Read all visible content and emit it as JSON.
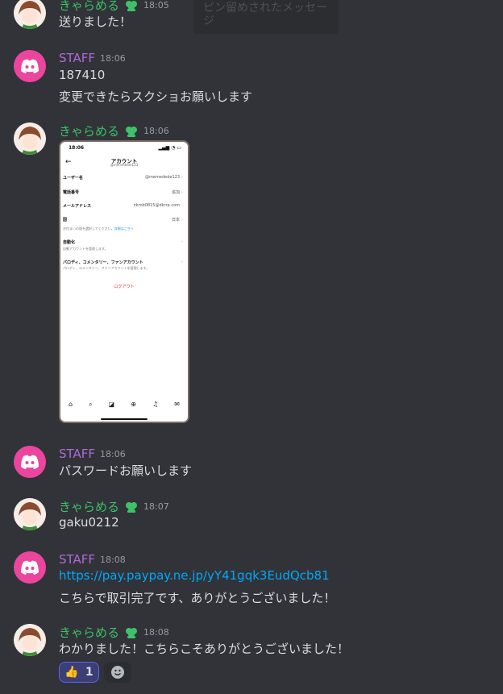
{
  "users": {
    "chara": "きゃらめる",
    "staff": "STAFF"
  },
  "tooltip": "ピン留めされたメッセージ",
  "messages": [
    {
      "time": "18:05",
      "text": "送りました！"
    },
    {
      "time": "18:06",
      "text1": "187410",
      "text2": "変更できたらスクショお願いします"
    },
    {
      "time": "18:06"
    },
    {
      "time": "18:06",
      "text": "パスワードお願いします"
    },
    {
      "time": "18:07",
      "text": "gaku0212"
    },
    {
      "time": "18:08",
      "link": "https://pay.paypay.ne.jp/yY41gqk3EudQcb81",
      "text": "こちらで取引完了です、ありがとうございました！"
    },
    {
      "time": "18:08",
      "text": "わかりました！こちらこそありがとうございました！"
    }
  ],
  "screenshot": {
    "status_time": "18:06",
    "title": "アカウント",
    "handle": "@memedede123",
    "rows": [
      {
        "key": "ユーザー名",
        "value": "@memedede123"
      },
      {
        "key": "電話番号",
        "value": "追加"
      },
      {
        "key": "メールアドレス",
        "value": "nkmb0815@dkrrp.com"
      },
      {
        "key": "国",
        "value": "日本"
      }
    ],
    "country_note": "お住まいの国を選択してください。",
    "country_link": "詳細はこちら",
    "automation_title": "自動化",
    "automation_desc": "自動アカウントを管理します。",
    "parody_title": "パロディ、コメンタリー、ファンアカウント",
    "parody_desc": "パロディ、コメンタリー、ファンアカウントを管理します。",
    "logout": "ログアウト"
  },
  "reaction": {
    "emoji": "👍",
    "count": "1"
  },
  "colors": {
    "staff": "#b069d8",
    "chara": "#3dc26a",
    "link": "#00a8fc",
    "discord": "#eb459e"
  }
}
